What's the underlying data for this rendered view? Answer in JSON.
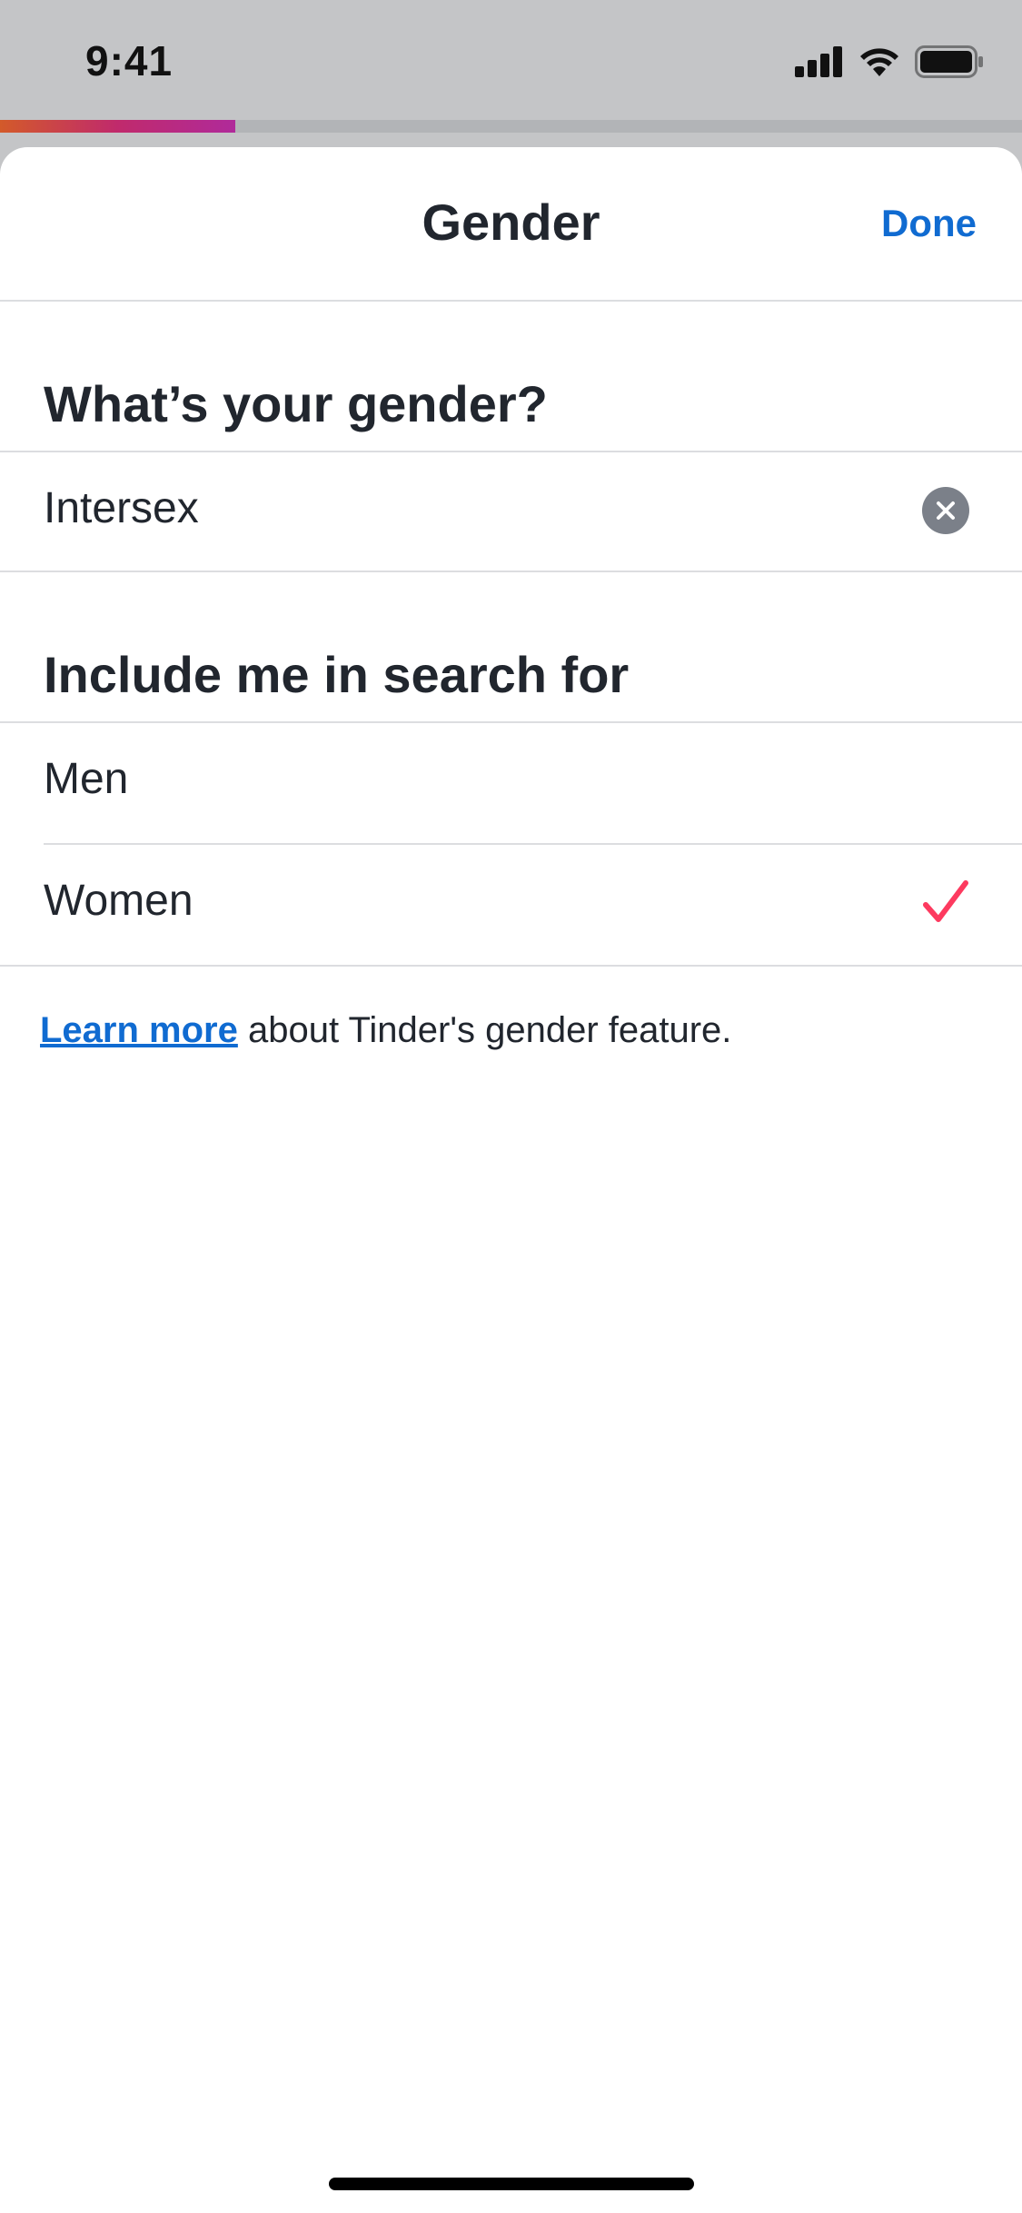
{
  "status_bar": {
    "time": "9:41",
    "icons": [
      "signal-icon",
      "wifi-icon",
      "battery-icon"
    ]
  },
  "progress": {
    "fraction": 0.23
  },
  "header": {
    "title": "Gender",
    "done_label": "Done"
  },
  "gender_section": {
    "heading": "What’s your gender?",
    "value": "Intersex",
    "clear_icon": "clear-icon"
  },
  "search_section": {
    "heading": "Include me in search for",
    "options": [
      {
        "label": "Men",
        "selected": false
      },
      {
        "label": "Women",
        "selected": true
      }
    ]
  },
  "footer": {
    "link_label": "Learn more",
    "text": " about Tinder's gender feature."
  },
  "colors": {
    "accent": "#106bd1",
    "check": "#fd3a5f",
    "text": "#21262e",
    "progress_start": "#d35a2a",
    "progress_end": "#b02a9a"
  }
}
